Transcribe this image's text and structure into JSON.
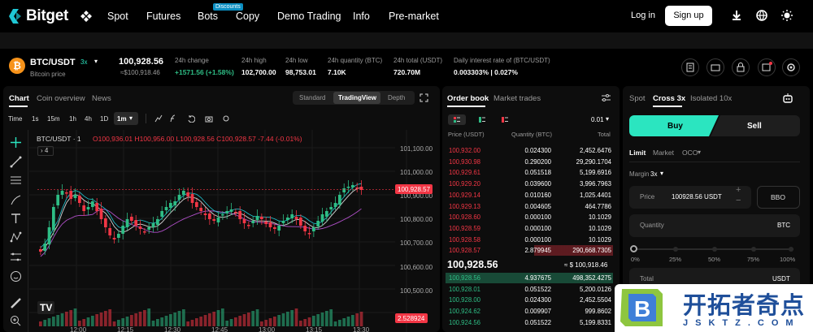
{
  "nav": {
    "brand": "Bitget",
    "items": [
      "Spot",
      "Futures",
      "Bots",
      "Copy",
      "Demo Trading",
      "Info",
      "Pre-market"
    ],
    "bots_badge": "Discounts",
    "login": "Log in",
    "signup": "Sign up"
  },
  "ticker": {
    "pair": "BTC/USDT",
    "leverage": "3x",
    "subtitle": "Bitcoin price",
    "last_price": "100,928.56",
    "last_price_usd": "≈$100,918.46",
    "change_label": "24h change",
    "change_value": "+1571.56 (+1.58%)",
    "high_label": "24h high",
    "high_value": "102,700.00",
    "low_label": "24h low",
    "low_value": "98,753.01",
    "qty_label": "24h quantity (BTC)",
    "qty_value": "7.10K",
    "total_label": "24h total (USDT)",
    "total_value": "720.70M",
    "interest_label": "Daily interest rate of (BTC/USDT)",
    "interest_value": "0.003303% | 0.027%"
  },
  "chart_panel": {
    "tabs": [
      "Chart",
      "Coin overview",
      "News"
    ],
    "view_modes": [
      "Standard",
      "TradingView",
      "Depth"
    ],
    "intervals": [
      "Time",
      "1s",
      "15m",
      "1h",
      "4h",
      "1D"
    ],
    "selected_interval": "1m",
    "legend": "BTC/USDT · 1",
    "ohlc": "O100,936.01 H100,956.00 L100,928.56 C100,928.57 -7.44 (-0.01%)",
    "indicator_count": "4",
    "price_axis": [
      "101,100.00",
      "101,000.00",
      "100,900.00",
      "100,800.00",
      "100,700.00",
      "100,600.00",
      "100,500.00"
    ],
    "last_price_tag": "100,928.57",
    "volume_tag": "2.528924",
    "time_axis": [
      "12:00",
      "12:15",
      "12:30",
      "12:45",
      "13:00",
      "13:15",
      "13:30"
    ]
  },
  "orderbook": {
    "tabs": [
      "Order book",
      "Market trades"
    ],
    "precision": "0.01",
    "headers": [
      "Price (USDT)",
      "Quantity (BTC)",
      "Total"
    ],
    "asks": [
      [
        "100,932.00",
        "0.024300",
        "2,452.6476"
      ],
      [
        "100,930.98",
        "0.290200",
        "29,290.1704"
      ],
      [
        "100,929.61",
        "0.051518",
        "5,199.6916"
      ],
      [
        "100,929.20",
        "0.039600",
        "3,996.7963"
      ],
      [
        "100,929.14",
        "0.010160",
        "1,025.4401"
      ],
      [
        "100,929.13",
        "0.004605",
        "464.7786"
      ],
      [
        "100,928.60",
        "0.000100",
        "10.1029"
      ],
      [
        "100,928.59",
        "0.000100",
        "10.1029"
      ],
      [
        "100,928.58",
        "0.000100",
        "10.1029"
      ],
      [
        "100,928.57",
        "2.879945",
        "290,668.7305"
      ]
    ],
    "mid_price": "100,928.56",
    "mid_usd": "≈ $ 100,918.46",
    "bids": [
      [
        "100,928.56",
        "4.937675",
        "498,352.4275"
      ],
      [
        "100,928.01",
        "0.051522",
        "5,200.0126"
      ],
      [
        "100,928.00",
        "0.024300",
        "2,452.5504"
      ],
      [
        "100,924.62",
        "0.009907",
        "999.8602"
      ],
      [
        "100,924.56",
        "0.051522",
        "5,199.8331"
      ]
    ]
  },
  "trade": {
    "tabs": [
      "Spot",
      "Cross 3x",
      "Isolated 10x"
    ],
    "buy": "Buy",
    "sell": "Sell",
    "order_types": [
      "Limit",
      "Market",
      "OCO"
    ],
    "margin_label": "Margin",
    "margin_value": "3x",
    "price_label": "Price",
    "price_value": "100928.56 USDT",
    "bbo": "BBO",
    "quantity_label": "Quantity",
    "quantity_unit": "BTC",
    "slider_marks": [
      "0%",
      "25%",
      "50%",
      "75%",
      "100%"
    ],
    "total_label": "Total",
    "total_unit": "USDT"
  },
  "watermark": {
    "text": "开拓者奇点",
    "url": "JSKTZ.COM"
  },
  "colors": {
    "up": "#2ebd85",
    "down": "#f23645",
    "accent": "#2be5c0"
  }
}
